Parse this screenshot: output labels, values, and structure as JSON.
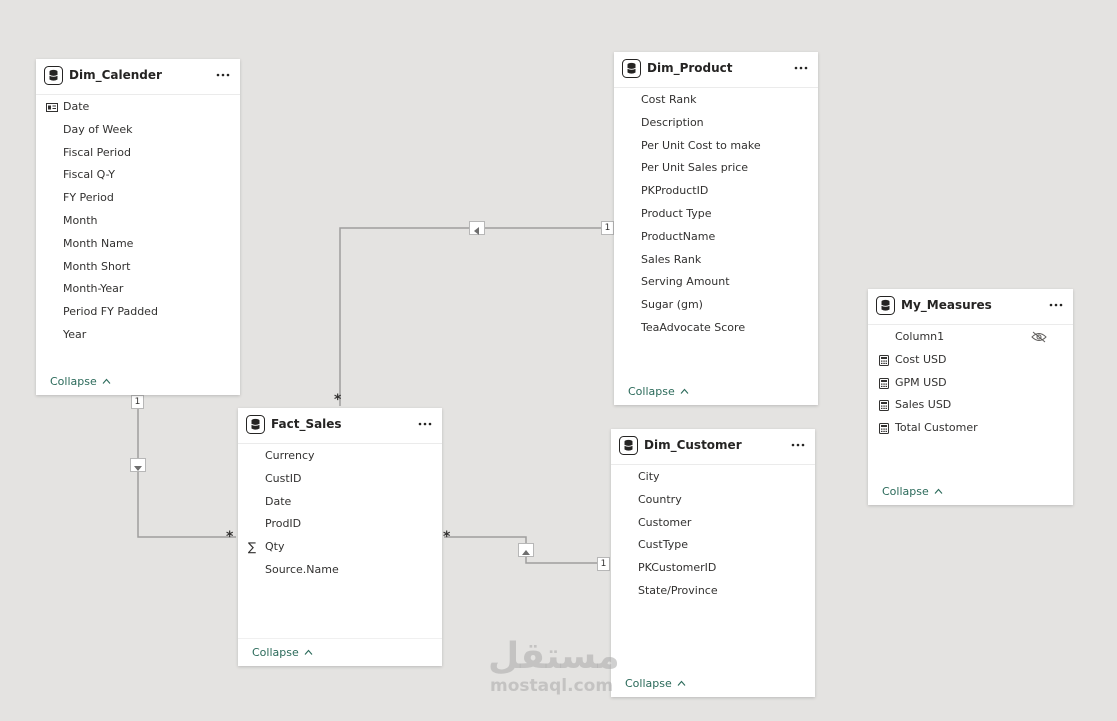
{
  "tables": {
    "dim_calender": {
      "title": "Dim_Calender",
      "fields": [
        "Date",
        "Day of Week",
        "Fiscal Period",
        "Fiscal Q-Y",
        "FY Period",
        "Month",
        "Month Name",
        "Month Short",
        "Month-Year",
        "Period FY Padded",
        "Year"
      ],
      "collapse": "Collapse"
    },
    "dim_product": {
      "title": "Dim_Product",
      "fields": [
        "Cost Rank",
        "Description",
        "Per Unit Cost to make",
        "Per Unit Sales price",
        "PKProductID",
        "Product Type",
        "ProductName",
        "Sales Rank",
        "Serving Amount",
        "Sugar (gm)",
        "TeaAdvocate Score"
      ],
      "collapse": "Collapse"
    },
    "my_measures": {
      "title": "My_Measures",
      "fields": [
        "Column1",
        "Cost USD",
        "GPM USD",
        "Sales USD",
        "Total Customer"
      ],
      "collapse": "Collapse"
    },
    "fact_sales": {
      "title": "Fact_Sales",
      "fields": [
        "Currency",
        "CustID",
        "Date",
        "ProdID",
        "Qty",
        "Source.Name"
      ],
      "collapse": "Collapse"
    },
    "dim_customer": {
      "title": "Dim_Customer",
      "fields": [
        "City",
        "Country",
        "Customer",
        "CustType",
        "PKCustomerID",
        "State/Province"
      ],
      "collapse": "Collapse"
    }
  },
  "relationships": {
    "calender_fact": {
      "one": "1",
      "many": "*"
    },
    "product_fact": {
      "one": "1",
      "many": "*"
    },
    "customer_fact": {
      "one": "1",
      "many": "*"
    }
  },
  "watermark": {
    "arabic": "مستقل",
    "latin": "mostaql.com"
  },
  "icons": {
    "table": "table-icon",
    "more": "more-options-icon",
    "date_field": "date-hierarchy-icon",
    "measure": "calculator-icon",
    "sum": "sigma-icon",
    "hidden": "eye-hidden-icon",
    "collapse": "chevron-up-icon"
  },
  "colors": {
    "canvas": "#e4e3e1",
    "card": "#ffffff",
    "collapse_link": "#2b6a5a",
    "line": "#9e9e9e"
  }
}
